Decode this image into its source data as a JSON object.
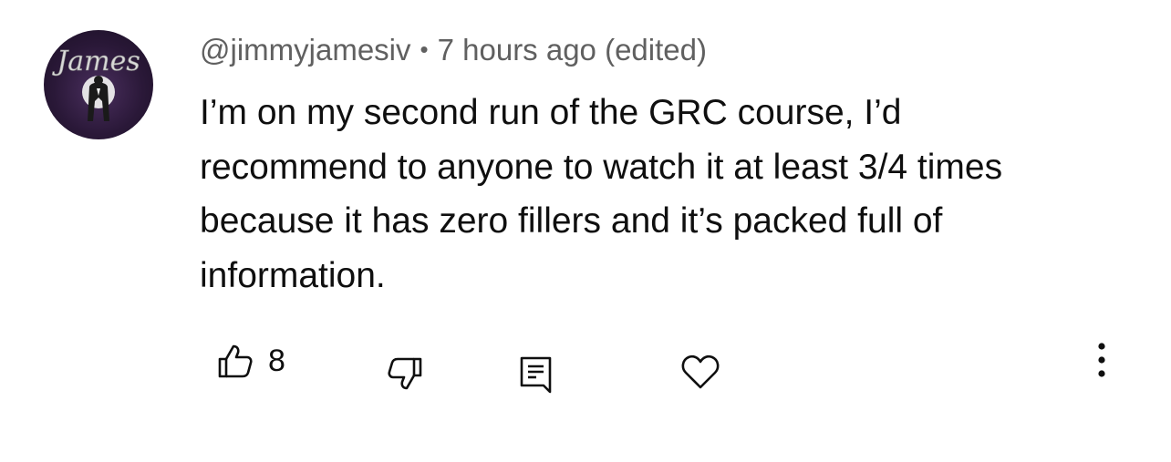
{
  "comment": {
    "avatar": {
      "icon": "avatar-james-logo",
      "logo_text": "James",
      "bg_color": "#2a1838"
    },
    "author": "@jimmyjamesiv",
    "separator": "•",
    "timestamp": "7 hours ago (edited)",
    "lines": [
      "I’m on my second run of the GRC course, I’d",
      "recommend to anyone to watch it at least 3/4 times",
      "because it has zero fillers and it’s packed full of",
      "information."
    ],
    "actions": {
      "like_icon": "thumbs-up-icon",
      "like_count": "8",
      "dislike_icon": "thumbs-down-icon",
      "reply_icon": "reply-comment-icon",
      "heart_icon": "heart-icon",
      "more_icon": "more-vertical-icon"
    },
    "colors": {
      "text_primary": "#0f0f0f",
      "text_secondary": "#606060",
      "icon": "#0f0f0f"
    }
  }
}
